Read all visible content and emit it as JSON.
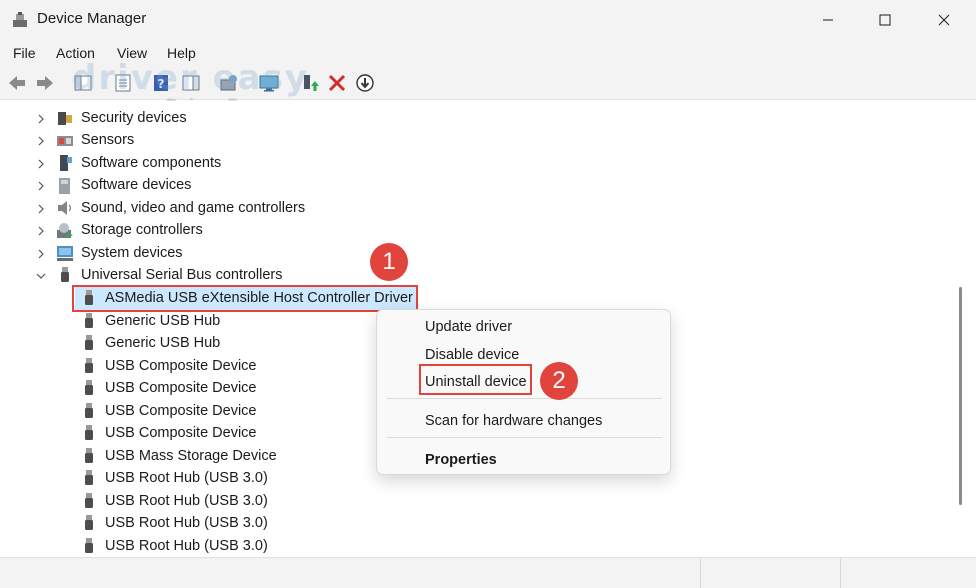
{
  "window": {
    "title": "Device Manager",
    "app_icon": "device-manager-icon",
    "controls": [
      "minimize-icon",
      "maximize-icon",
      "close-icon"
    ]
  },
  "menu": [
    "File",
    "Action",
    "View",
    "Help"
  ],
  "toolbar": {
    "icons": [
      "back-arrow-icon",
      "forward-arrow-icon",
      "show-hide-console-tree-icon",
      "properties-sheet-icon",
      "help-icon",
      "action-pane-icon",
      "scan-hardware-icon",
      "monitor-icon",
      "update-driver-icon",
      "uninstall-x-icon",
      "download-icon"
    ],
    "watermark": "driver easy",
    "watermark_url": "www.DriverEasy.com"
  },
  "tree": {
    "categories": [
      {
        "label": "Security devices",
        "icon": "security-device-icon",
        "expanded": false
      },
      {
        "label": "Sensors",
        "icon": "sensors-icon",
        "expanded": false
      },
      {
        "label": "Software components",
        "icon": "software-component-icon",
        "expanded": false
      },
      {
        "label": "Software devices",
        "icon": "software-device-icon",
        "expanded": false
      },
      {
        "label": "Sound, video and game controllers",
        "icon": "speaker-icon",
        "expanded": false
      },
      {
        "label": "Storage controllers",
        "icon": "storage-controller-icon",
        "expanded": false
      },
      {
        "label": "System devices",
        "icon": "system-device-icon",
        "expanded": false
      },
      {
        "label": "Universal Serial Bus controllers",
        "icon": "usb-icon",
        "expanded": true
      }
    ],
    "usb_children": [
      "ASMedia USB eXtensible Host Controller Driver",
      "Generic USB Hub",
      "Generic USB Hub",
      "USB Composite Device",
      "USB Composite Device",
      "USB Composite Device",
      "USB Composite Device",
      "USB Mass Storage Device",
      "USB Root Hub (USB 3.0)",
      "USB Root Hub (USB 3.0)",
      "USB Root Hub (USB 3.0)",
      "USB Root Hub (USB 3.0)"
    ],
    "selected": "ASMedia USB eXtensible Host Controller Driver"
  },
  "context_menu": {
    "items": [
      "Update driver",
      "Disable device",
      "Uninstall device",
      "Scan for hardware changes",
      "Properties"
    ],
    "bold_item": "Properties",
    "highlighted_item": "Uninstall device"
  },
  "annotations": {
    "step1": "1",
    "step2": "2",
    "color": "#e0443c"
  },
  "colors": {
    "selection": "#cce8ff",
    "chrome": "#f3f3f3",
    "annotation_red": "#e0443c"
  }
}
